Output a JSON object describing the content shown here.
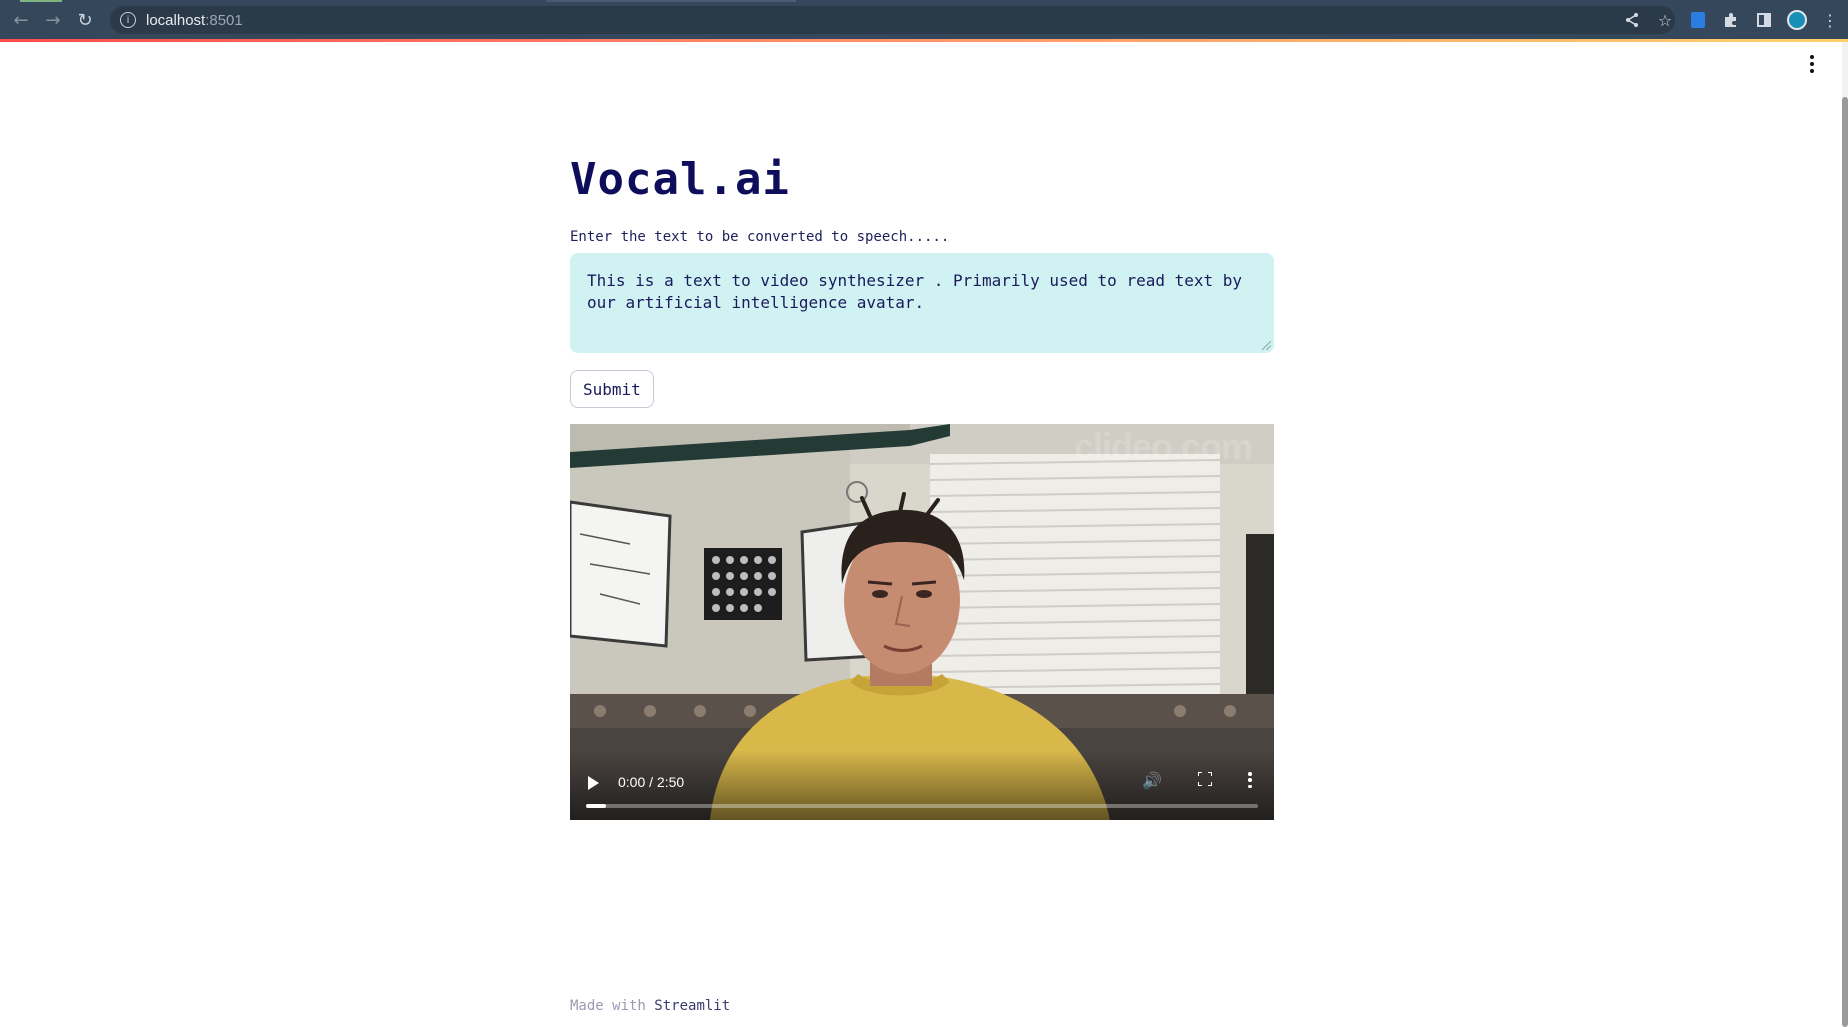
{
  "browser": {
    "url_host": "localhost",
    "url_port": ":8501",
    "info_icon": "info-icon",
    "back_icon": "arrow-left-icon",
    "forward_icon": "arrow-right-icon",
    "reload_icon": "reload-icon",
    "right_icons": [
      "share-icon",
      "star-icon",
      "extension-blue-icon",
      "puzzle-icon",
      "sidebar-icon",
      "profile-avatar",
      "kebab-menu-icon"
    ]
  },
  "app": {
    "title": "Vocal.ai",
    "input_label": "Enter the text to be converted to speech.....",
    "textarea_value": "This is a text to video synthesizer . Primarily used to read text by our artificial intelligence avatar.",
    "submit_label": "Submit",
    "menu_icon": "kebab-menu-icon"
  },
  "video": {
    "time": "0:00 / 2:50",
    "progress_fraction": 0.03,
    "watermark": "clideo.com",
    "icons": [
      "play-icon",
      "volume-icon",
      "fullscreen-icon",
      "more-options-icon"
    ]
  },
  "footer": {
    "prefix": "Made with",
    "link": "Streamlit"
  },
  "colors": {
    "title": "#0d0d5c",
    "textarea_bg": "#d0f2f2",
    "chrome_bg": "#35475a"
  }
}
